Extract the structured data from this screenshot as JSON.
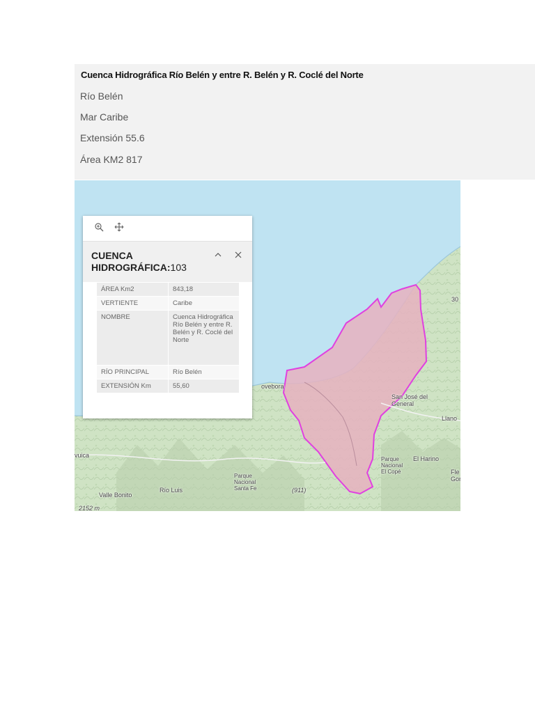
{
  "info": {
    "title": "Cuenca Hidrográfica Río Belén y entre R. Belén y R. Coclé del Norte",
    "lines": [
      "Río Belén",
      "Mar Caribe",
      "Extensión 55.6",
      "Área KM2 817"
    ]
  },
  "map": {
    "labels": {
      "novebora": "ovebora",
      "san_jose": "San José del General",
      "llano": "Llano",
      "el_harino": "El Harino",
      "parque_copé": "Parque Nacional El Copé",
      "parque_santa_fe": "Parque Nacional Santa Fe",
      "rio_luis": "Río Luis",
      "valle_bonito": "Valle Bonito",
      "elev": "2152 m",
      "num30": "30",
      "road": "(911)",
      "vuica": "vuica",
      "fle": "Fle",
      "go": "Gor"
    },
    "colors": {
      "sea": "#bfe3f2",
      "basin_fill": "#e6b2c0",
      "basin_stroke": "#e040e0",
      "land": "#cfe3c4"
    }
  },
  "popup": {
    "toolbar": {
      "zoom_icon": "zoom-in-icon",
      "pan_icon": "pan-icon"
    },
    "title_main": "CUENCA HIDROGRÁFICA:",
    "title_num": "103",
    "rows": [
      {
        "key": "ÁREA Km2",
        "value": "843,18"
      },
      {
        "key": "VERTIENTE",
        "value": "Caribe"
      },
      {
        "key": "NOMBRE",
        "value": "Cuenca Hidrográfica Río Belén y entre R. Belén y R. Coclé del Norte"
      },
      {
        "key": "RÍO PRINCIPAL",
        "value": "Río Belén"
      },
      {
        "key": "EXTENSIÓN Km",
        "value": "55,60"
      }
    ]
  }
}
